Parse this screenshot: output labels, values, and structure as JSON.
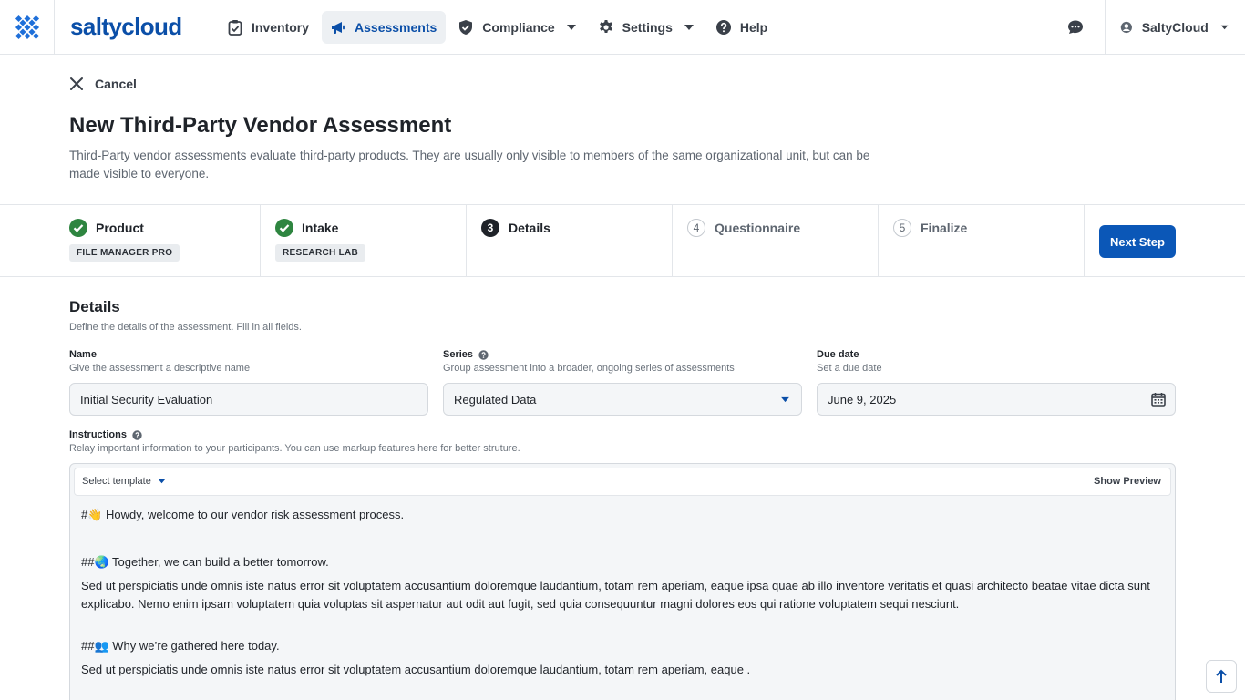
{
  "brand": {
    "name": "saltycloud"
  },
  "nav": {
    "items": [
      {
        "label": "Inventory",
        "icon": "clipboard-check-icon"
      },
      {
        "label": "Assessments",
        "icon": "megaphone-icon",
        "active": true
      },
      {
        "label": "Compliance",
        "icon": "shield-check-icon",
        "dropdown": true
      },
      {
        "label": "Settings",
        "icon": "gear-icon",
        "dropdown": true
      },
      {
        "label": "Help",
        "icon": "question-circle-icon"
      }
    ],
    "user": "SaltyCloud"
  },
  "header": {
    "cancel": "Cancel",
    "title": "New Third-Party Vendor Assessment",
    "subtitle": "Third-Party vendor assessments evaluate third-party products. They are usually only visible to members of the same organizational unit, but can be made visible to everyone."
  },
  "stepper": {
    "steps": [
      {
        "number": "1",
        "label": "Product",
        "status": "done",
        "chip": "FILE MANAGER PRO"
      },
      {
        "number": "2",
        "label": "Intake",
        "status": "done",
        "chip": "RESEARCH LAB"
      },
      {
        "number": "3",
        "label": "Details",
        "status": "current"
      },
      {
        "number": "4",
        "label": "Questionnaire",
        "status": "future"
      },
      {
        "number": "5",
        "label": "Finalize",
        "status": "future"
      }
    ],
    "next_label": "Next Step"
  },
  "details": {
    "title": "Details",
    "description": "Define the details of the assessment. Fill in all fields.",
    "name": {
      "label": "Name",
      "hint": "Give the assessment a descriptive name",
      "value": "Initial Security Evaluation"
    },
    "series": {
      "label": "Series",
      "hint": "Group assessment into a broader, ongoing series of assessments",
      "value": "Regulated Data"
    },
    "due_date": {
      "label": "Due date",
      "hint": "Set a due date",
      "value": "June 9, 2025"
    },
    "instructions": {
      "label": "Instructions",
      "hint": "Relay important information to your participants. You can use markup features here for better struture.",
      "template_label": "Select template",
      "preview_label": "Show Preview",
      "lines": [
        "#👋 Howdy, welcome to our vendor risk assessment process.",
        "##🌏 Together, we can build a better tomorrow.",
        "Sed ut perspiciatis unde omnis iste natus error sit voluptatem accusantium doloremque laudantium, totam rem aperiam, eaque ipsa quae ab illo inventore veritatis et quasi architecto beatae vitae dicta sunt explicabo. Nemo enim ipsam voluptatem quia voluptas sit aspernatur aut odit aut fugit, sed quia consequuntur magni dolores eos qui ratione voluptatem sequi nesciunt.",
        "##👥 Why we’re gathered here today.",
        "Sed ut perspiciatis unde omnis iste natus error sit voluptatem accusantium doloremque laudantium, totam rem aperiam, eaque ."
      ]
    }
  },
  "colors": {
    "brand": "#0b4fa8",
    "primary_button": "#0b57b7",
    "success": "#2e8540"
  }
}
